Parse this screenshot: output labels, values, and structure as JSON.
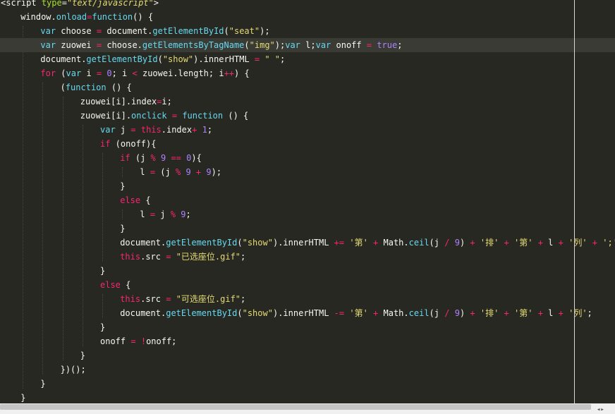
{
  "editor": {
    "theme_colors": {
      "background": "#272822",
      "active_line": "#3a3b35",
      "keyword": "#f92672",
      "string": "#e6db74",
      "function": "#66d9ef",
      "number": "#ae81ff",
      "attribute": "#a6e22e",
      "text": "#f8f8f2"
    },
    "active_line_index": 3,
    "lines": [
      {
        "indent": 0,
        "tokens": [
          {
            "t": "<script",
            "c": "tag"
          },
          {
            "t": " ",
            "c": "plain"
          },
          {
            "t": "type",
            "c": "attr"
          },
          {
            "t": "=",
            "c": "plain"
          },
          {
            "t": "\"text/javascript\"",
            "c": "attrv"
          },
          {
            "t": ">",
            "c": "tag"
          }
        ]
      },
      {
        "indent": 1,
        "tokens": [
          {
            "t": "window.",
            "c": "plain"
          },
          {
            "t": "onload",
            "c": "fn"
          },
          {
            "t": "=",
            "c": "kw"
          },
          {
            "t": "function",
            "c": "fn"
          },
          {
            "t": "() {",
            "c": "plain"
          }
        ]
      },
      {
        "indent": 2,
        "tokens": [
          {
            "t": "var",
            "c": "fn"
          },
          {
            "t": " choose ",
            "c": "plain"
          },
          {
            "t": "=",
            "c": "kw"
          },
          {
            "t": " document.",
            "c": "plain"
          },
          {
            "t": "getElementById",
            "c": "fn"
          },
          {
            "t": "(",
            "c": "plain"
          },
          {
            "t": "\"seat\"",
            "c": "str"
          },
          {
            "t": ");",
            "c": "plain"
          }
        ]
      },
      {
        "indent": 2,
        "tokens": [
          {
            "t": "var",
            "c": "fn"
          },
          {
            "t": " zuowei ",
            "c": "plain"
          },
          {
            "t": "=",
            "c": "kw"
          },
          {
            "t": " choose.",
            "c": "plain"
          },
          {
            "t": "getElementsByTagName",
            "c": "fn"
          },
          {
            "t": "(",
            "c": "plain"
          },
          {
            "t": "\"img\"",
            "c": "str"
          },
          {
            "t": ");",
            "c": "plain"
          },
          {
            "t": "var",
            "c": "fn"
          },
          {
            "t": " l;",
            "c": "plain"
          },
          {
            "t": "var",
            "c": "fn"
          },
          {
            "t": " onoff ",
            "c": "plain"
          },
          {
            "t": "=",
            "c": "kw"
          },
          {
            "t": " ",
            "c": "plain"
          },
          {
            "t": "true",
            "c": "bool"
          },
          {
            "t": ";",
            "c": "plain"
          }
        ]
      },
      {
        "indent": 2,
        "tokens": [
          {
            "t": "document.",
            "c": "plain"
          },
          {
            "t": "getElementById",
            "c": "fn"
          },
          {
            "t": "(",
            "c": "plain"
          },
          {
            "t": "\"show\"",
            "c": "str"
          },
          {
            "t": ").innerHTML ",
            "c": "plain"
          },
          {
            "t": "=",
            "c": "kw"
          },
          {
            "t": " ",
            "c": "plain"
          },
          {
            "t": "\" \"",
            "c": "str"
          },
          {
            "t": ";",
            "c": "plain"
          }
        ]
      },
      {
        "indent": 2,
        "tokens": [
          {
            "t": "for",
            "c": "kw"
          },
          {
            "t": " (",
            "c": "plain"
          },
          {
            "t": "var",
            "c": "fn"
          },
          {
            "t": " i ",
            "c": "plain"
          },
          {
            "t": "=",
            "c": "kw"
          },
          {
            "t": " ",
            "c": "plain"
          },
          {
            "t": "0",
            "c": "num"
          },
          {
            "t": "; i ",
            "c": "plain"
          },
          {
            "t": "<",
            "c": "kw"
          },
          {
            "t": " zuowei.length; i",
            "c": "plain"
          },
          {
            "t": "++",
            "c": "kw"
          },
          {
            "t": ") {",
            "c": "plain"
          }
        ]
      },
      {
        "indent": 3,
        "tokens": [
          {
            "t": "(",
            "c": "plain"
          },
          {
            "t": "function",
            "c": "fn"
          },
          {
            "t": " () {",
            "c": "plain"
          }
        ]
      },
      {
        "indent": 4,
        "tokens": [
          {
            "t": "zuowei[i].index",
            "c": "plain"
          },
          {
            "t": "=",
            "c": "kw"
          },
          {
            "t": "i;",
            "c": "plain"
          }
        ]
      },
      {
        "indent": 4,
        "tokens": [
          {
            "t": "zuowei[i].",
            "c": "plain"
          },
          {
            "t": "onclick",
            "c": "fn"
          },
          {
            "t": " ",
            "c": "plain"
          },
          {
            "t": "=",
            "c": "kw"
          },
          {
            "t": " ",
            "c": "plain"
          },
          {
            "t": "function",
            "c": "fn"
          },
          {
            "t": " () {",
            "c": "plain"
          }
        ]
      },
      {
        "indent": 5,
        "tokens": [
          {
            "t": "var",
            "c": "fn"
          },
          {
            "t": " j ",
            "c": "plain"
          },
          {
            "t": "=",
            "c": "kw"
          },
          {
            "t": " ",
            "c": "plain"
          },
          {
            "t": "this",
            "c": "kw"
          },
          {
            "t": ".index",
            "c": "plain"
          },
          {
            "t": "+",
            "c": "kw"
          },
          {
            "t": " ",
            "c": "plain"
          },
          {
            "t": "1",
            "c": "num"
          },
          {
            "t": ";",
            "c": "plain"
          }
        ]
      },
      {
        "indent": 5,
        "tokens": [
          {
            "t": "if",
            "c": "kw"
          },
          {
            "t": " (onoff){",
            "c": "plain"
          }
        ]
      },
      {
        "indent": 6,
        "tokens": [
          {
            "t": "if",
            "c": "kw"
          },
          {
            "t": " (j ",
            "c": "plain"
          },
          {
            "t": "%",
            "c": "kw"
          },
          {
            "t": " ",
            "c": "plain"
          },
          {
            "t": "9",
            "c": "num"
          },
          {
            "t": " ",
            "c": "plain"
          },
          {
            "t": "==",
            "c": "kw"
          },
          {
            "t": " ",
            "c": "plain"
          },
          {
            "t": "0",
            "c": "num"
          },
          {
            "t": "){",
            "c": "plain"
          }
        ]
      },
      {
        "indent": 7,
        "tokens": [
          {
            "t": "l ",
            "c": "plain"
          },
          {
            "t": "=",
            "c": "kw"
          },
          {
            "t": " (j ",
            "c": "plain"
          },
          {
            "t": "%",
            "c": "kw"
          },
          {
            "t": " ",
            "c": "plain"
          },
          {
            "t": "9",
            "c": "num"
          },
          {
            "t": " ",
            "c": "plain"
          },
          {
            "t": "+",
            "c": "kw"
          },
          {
            "t": " ",
            "c": "plain"
          },
          {
            "t": "9",
            "c": "num"
          },
          {
            "t": ");",
            "c": "plain"
          }
        ]
      },
      {
        "indent": 6,
        "tokens": [
          {
            "t": "}",
            "c": "plain"
          }
        ]
      },
      {
        "indent": 6,
        "tokens": [
          {
            "t": "else",
            "c": "kw"
          },
          {
            "t": " {",
            "c": "plain"
          }
        ]
      },
      {
        "indent": 7,
        "tokens": [
          {
            "t": "l ",
            "c": "plain"
          },
          {
            "t": "=",
            "c": "kw"
          },
          {
            "t": " j ",
            "c": "plain"
          },
          {
            "t": "%",
            "c": "kw"
          },
          {
            "t": " ",
            "c": "plain"
          },
          {
            "t": "9",
            "c": "num"
          },
          {
            "t": ";",
            "c": "plain"
          }
        ]
      },
      {
        "indent": 6,
        "tokens": [
          {
            "t": "}",
            "c": "plain"
          }
        ]
      },
      {
        "indent": 6,
        "tokens": [
          {
            "t": "document.",
            "c": "plain"
          },
          {
            "t": "getElementById",
            "c": "fn"
          },
          {
            "t": "(",
            "c": "plain"
          },
          {
            "t": "\"show\"",
            "c": "str"
          },
          {
            "t": ").innerHTML ",
            "c": "plain"
          },
          {
            "t": "+=",
            "c": "kw"
          },
          {
            "t": " ",
            "c": "plain"
          },
          {
            "t": "'第'",
            "c": "str"
          },
          {
            "t": " ",
            "c": "plain"
          },
          {
            "t": "+",
            "c": "kw"
          },
          {
            "t": " Math.",
            "c": "plain"
          },
          {
            "t": "ceil",
            "c": "fn"
          },
          {
            "t": "(j ",
            "c": "plain"
          },
          {
            "t": "/",
            "c": "kw"
          },
          {
            "t": " ",
            "c": "plain"
          },
          {
            "t": "9",
            "c": "num"
          },
          {
            "t": ") ",
            "c": "plain"
          },
          {
            "t": "+",
            "c": "kw"
          },
          {
            "t": " ",
            "c": "plain"
          },
          {
            "t": "'排'",
            "c": "str"
          },
          {
            "t": " ",
            "c": "plain"
          },
          {
            "t": "+",
            "c": "kw"
          },
          {
            "t": " ",
            "c": "plain"
          },
          {
            "t": "'第'",
            "c": "str"
          },
          {
            "t": " ",
            "c": "plain"
          },
          {
            "t": "+",
            "c": "kw"
          },
          {
            "t": " l ",
            "c": "plain"
          },
          {
            "t": "+",
            "c": "kw"
          },
          {
            "t": " ",
            "c": "plain"
          },
          {
            "t": "'列'",
            "c": "str"
          },
          {
            "t": " ",
            "c": "plain"
          },
          {
            "t": "+",
            "c": "kw"
          },
          {
            "t": " ",
            "c": "plain"
          },
          {
            "t": "';'",
            "c": "str"
          },
          {
            "t": ";",
            "c": "plain"
          }
        ]
      },
      {
        "indent": 6,
        "tokens": [
          {
            "t": "this",
            "c": "kw"
          },
          {
            "t": ".src ",
            "c": "plain"
          },
          {
            "t": "=",
            "c": "kw"
          },
          {
            "t": " ",
            "c": "plain"
          },
          {
            "t": "\"已选座位.gif\"",
            "c": "str"
          },
          {
            "t": ";",
            "c": "plain"
          }
        ]
      },
      {
        "indent": 5,
        "tokens": [
          {
            "t": "}",
            "c": "plain"
          }
        ]
      },
      {
        "indent": 5,
        "tokens": [
          {
            "t": "else",
            "c": "kw"
          },
          {
            "t": " {",
            "c": "plain"
          }
        ]
      },
      {
        "indent": 6,
        "tokens": [
          {
            "t": "this",
            "c": "kw"
          },
          {
            "t": ".src ",
            "c": "plain"
          },
          {
            "t": "=",
            "c": "kw"
          },
          {
            "t": " ",
            "c": "plain"
          },
          {
            "t": "\"可选座位.gif\"",
            "c": "str"
          },
          {
            "t": ";",
            "c": "plain"
          }
        ]
      },
      {
        "indent": 6,
        "tokens": [
          {
            "t": "document.",
            "c": "plain"
          },
          {
            "t": "getElementById",
            "c": "fn"
          },
          {
            "t": "(",
            "c": "plain"
          },
          {
            "t": "\"show\"",
            "c": "str"
          },
          {
            "t": ").innerHTML ",
            "c": "plain"
          },
          {
            "t": "-=",
            "c": "kw"
          },
          {
            "t": " ",
            "c": "plain"
          },
          {
            "t": "'第'",
            "c": "str"
          },
          {
            "t": " ",
            "c": "plain"
          },
          {
            "t": "+",
            "c": "kw"
          },
          {
            "t": " Math.",
            "c": "plain"
          },
          {
            "t": "ceil",
            "c": "fn"
          },
          {
            "t": "(j ",
            "c": "plain"
          },
          {
            "t": "/",
            "c": "kw"
          },
          {
            "t": " ",
            "c": "plain"
          },
          {
            "t": "9",
            "c": "num"
          },
          {
            "t": ") ",
            "c": "plain"
          },
          {
            "t": "+",
            "c": "kw"
          },
          {
            "t": " ",
            "c": "plain"
          },
          {
            "t": "'排'",
            "c": "str"
          },
          {
            "t": " ",
            "c": "plain"
          },
          {
            "t": "+",
            "c": "kw"
          },
          {
            "t": " ",
            "c": "plain"
          },
          {
            "t": "'第'",
            "c": "str"
          },
          {
            "t": " ",
            "c": "plain"
          },
          {
            "t": "+",
            "c": "kw"
          },
          {
            "t": " l ",
            "c": "plain"
          },
          {
            "t": "+",
            "c": "kw"
          },
          {
            "t": " ",
            "c": "plain"
          },
          {
            "t": "'列'",
            "c": "str"
          },
          {
            "t": ";",
            "c": "plain"
          }
        ]
      },
      {
        "indent": 5,
        "tokens": [
          {
            "t": "}",
            "c": "plain"
          }
        ]
      },
      {
        "indent": 5,
        "tokens": [
          {
            "t": "onoff ",
            "c": "plain"
          },
          {
            "t": "=",
            "c": "kw"
          },
          {
            "t": " ",
            "c": "plain"
          },
          {
            "t": "!",
            "c": "kw"
          },
          {
            "t": "onoff;",
            "c": "plain"
          }
        ]
      },
      {
        "indent": 4,
        "tokens": [
          {
            "t": "}",
            "c": "plain"
          }
        ]
      },
      {
        "indent": 3,
        "tokens": [
          {
            "t": "})();",
            "c": "plain"
          }
        ]
      },
      {
        "indent": 2,
        "tokens": [
          {
            "t": "}",
            "c": "plain"
          }
        ]
      },
      {
        "indent": 1,
        "tokens": [
          {
            "t": "}",
            "c": "plain"
          }
        ]
      }
    ]
  }
}
